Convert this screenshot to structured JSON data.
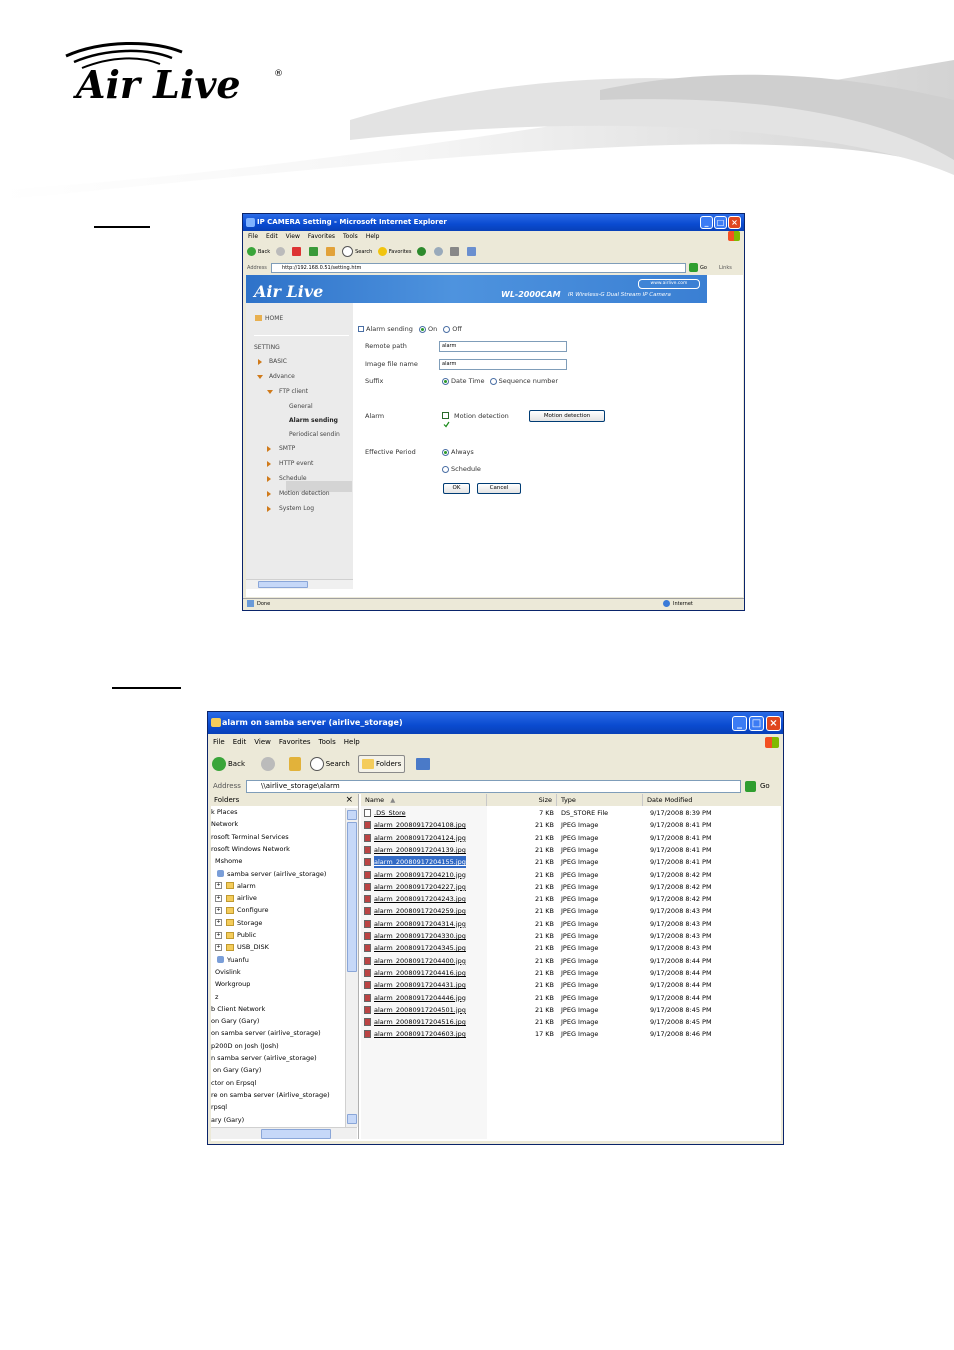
{
  "header": {
    "brand": "Air Live",
    "registered": "®"
  },
  "step_labels": [
    "",
    ""
  ],
  "ie": {
    "title": "IP CAMERA Setting - Microsoft Internet Explorer",
    "menu": [
      "File",
      "Edit",
      "View",
      "Favorites",
      "Tools",
      "Help"
    ],
    "toolbar": {
      "back": "Back",
      "search": "Search",
      "favorites": "Favorites"
    },
    "address_label": "Address",
    "address": "http://192.168.0.51/setting.htm",
    "go": "Go",
    "links": "Links",
    "banner": {
      "logo": "Air Live",
      "url": "www.airlive.com",
      "model": "WL-2000CAM",
      "subtitle": "IR Wireless-G Dual Stream IP Camera"
    },
    "nav": {
      "home": "HOME",
      "setting": "SETTING",
      "basic": "BASIC",
      "advance": "Advance",
      "ftp_client": "FTP client",
      "general": "General",
      "alarm_sending": "Alarm sending",
      "periodical": "Periodical sendin",
      "smtp": "SMTP",
      "http_event": "HTTP event",
      "schedule": "Schedule",
      "motion": "Motion detection",
      "syslog": "System Log"
    },
    "form": {
      "alarm_sending": "Alarm sending",
      "on": "On",
      "off": "Off",
      "remote_path_label": "Remote path",
      "remote_path_value": "alarm",
      "image_file_label": "Image file name",
      "image_file_value": "alarm",
      "suffix_label": "Suffix",
      "date_time": "Date Time",
      "sequence": "Sequence number",
      "alarm_label": "Alarm",
      "motion_detection": "Motion detection",
      "motion_button": "Motion detection",
      "effective_label": "Effective Period",
      "always": "Always",
      "schedule": "Schedule",
      "ok": "OK",
      "cancel": "Cancel"
    },
    "status": {
      "done": "Done",
      "zone": "Internet"
    }
  },
  "explorer": {
    "title": "alarm on samba server (airlive_storage)",
    "menu": [
      "File",
      "Edit",
      "View",
      "Favorites",
      "Tools",
      "Help"
    ],
    "toolbar": {
      "back": "Back",
      "search": "Search",
      "folders": "Folders"
    },
    "address_label": "Address",
    "address": "\\\\airlive_storage\\alarm",
    "go": "Go",
    "folders_title": "Folders",
    "close": "×",
    "tree": [
      {
        "label": "k Places",
        "indent": 0,
        "type": "text"
      },
      {
        "label": "Network",
        "indent": 0,
        "type": "text"
      },
      {
        "label": "rosoft Terminal Services",
        "indent": 0,
        "type": "text"
      },
      {
        "label": "rosoft Windows Network",
        "indent": 0,
        "type": "text"
      },
      {
        "label": "Mshome",
        "indent": 4,
        "type": "text"
      },
      {
        "label": "samba server (airlive_storage)",
        "indent": 6,
        "type": "net"
      },
      {
        "label": "alarm",
        "indent": 4,
        "type": "folder"
      },
      {
        "label": "airlive",
        "indent": 4,
        "type": "folder"
      },
      {
        "label": "Configure",
        "indent": 4,
        "type": "folder"
      },
      {
        "label": "Storage",
        "indent": 4,
        "type": "folder"
      },
      {
        "label": "Public",
        "indent": 4,
        "type": "folder"
      },
      {
        "label": "USB_DISK",
        "indent": 4,
        "type": "folder"
      },
      {
        "label": "Yuanfu",
        "indent": 6,
        "type": "net"
      },
      {
        "label": "Ovislink",
        "indent": 4,
        "type": "text"
      },
      {
        "label": "Workgroup",
        "indent": 4,
        "type": "text"
      },
      {
        "label": "z",
        "indent": 4,
        "type": "text"
      },
      {
        "label": "b Client Network",
        "indent": 0,
        "type": "text"
      },
      {
        "label": "on Gary (Gary)",
        "indent": 0,
        "type": "text"
      },
      {
        "label": "on samba server (airlive_storage)",
        "indent": 0,
        "type": "text"
      },
      {
        "label": "p200D on Josh (Josh)",
        "indent": 0,
        "type": "text"
      },
      {
        "label": "n samba server (airlive_storage)",
        "indent": 0,
        "type": "text"
      },
      {
        "label": "on Gary (Gary)",
        "indent": 2,
        "type": "text"
      },
      {
        "label": "ctor on Erpsql",
        "indent": 0,
        "type": "text"
      },
      {
        "label": "re on samba server (Airlive_storage)",
        "indent": 0,
        "type": "text"
      },
      {
        "label": "rpsql",
        "indent": 0,
        "type": "text"
      },
      {
        "label": "ary (Gary)",
        "indent": 0,
        "type": "text"
      }
    ],
    "columns": {
      "name": "Name",
      "size": "Size",
      "type": "Type",
      "date": "Date Modified"
    },
    "files": [
      {
        "name": ".DS_Store",
        "size": "7 KB",
        "type": "DS_STORE File",
        "date": "9/17/2008 8:39 PM"
      },
      {
        "name": "alarm_20080917204108.jpg",
        "size": "21 KB",
        "type": "JPEG Image",
        "date": "9/17/2008 8:41 PM"
      },
      {
        "name": "alarm_20080917204124.jpg",
        "size": "21 KB",
        "type": "JPEG Image",
        "date": "9/17/2008 8:41 PM"
      },
      {
        "name": "alarm_20080917204139.jpg",
        "size": "21 KB",
        "type": "JPEG Image",
        "date": "9/17/2008 8:41 PM"
      },
      {
        "name": "alarm_20080917204155.jpg",
        "size": "21 KB",
        "type": "JPEG Image",
        "date": "9/17/2008 8:41 PM"
      },
      {
        "name": "alarm_20080917204210.jpg",
        "size": "21 KB",
        "type": "JPEG Image",
        "date": "9/17/2008 8:42 PM"
      },
      {
        "name": "alarm_20080917204227.jpg",
        "size": "21 KB",
        "type": "JPEG Image",
        "date": "9/17/2008 8:42 PM"
      },
      {
        "name": "alarm_20080917204243.jpg",
        "size": "21 KB",
        "type": "JPEG Image",
        "date": "9/17/2008 8:42 PM"
      },
      {
        "name": "alarm_20080917204259.jpg",
        "size": "21 KB",
        "type": "JPEG Image",
        "date": "9/17/2008 8:43 PM"
      },
      {
        "name": "alarm_20080917204314.jpg",
        "size": "21 KB",
        "type": "JPEG Image",
        "date": "9/17/2008 8:43 PM"
      },
      {
        "name": "alarm_20080917204330.jpg",
        "size": "21 KB",
        "type": "JPEG Image",
        "date": "9/17/2008 8:43 PM"
      },
      {
        "name": "alarm_20080917204345.jpg",
        "size": "21 KB",
        "type": "JPEG Image",
        "date": "9/17/2008 8:43 PM"
      },
      {
        "name": "alarm_20080917204400.jpg",
        "size": "21 KB",
        "type": "JPEG Image",
        "date": "9/17/2008 8:44 PM"
      },
      {
        "name": "alarm_20080917204416.jpg",
        "size": "21 KB",
        "type": "JPEG Image",
        "date": "9/17/2008 8:44 PM"
      },
      {
        "name": "alarm_20080917204431.jpg",
        "size": "21 KB",
        "type": "JPEG Image",
        "date": "9/17/2008 8:44 PM"
      },
      {
        "name": "alarm_20080917204446.jpg",
        "size": "21 KB",
        "type": "JPEG Image",
        "date": "9/17/2008 8:44 PM"
      },
      {
        "name": "alarm_20080917204501.jpg",
        "size": "21 KB",
        "type": "JPEG Image",
        "date": "9/17/2008 8:45 PM"
      },
      {
        "name": "alarm_20080917204516.jpg",
        "size": "21 KB",
        "type": "JPEG Image",
        "date": "9/17/2008 8:45 PM"
      },
      {
        "name": "alarm_20080917204603.jpg",
        "size": "17 KB",
        "type": "JPEG Image",
        "date": "9/17/2008 8:46 PM"
      }
    ],
    "selected_file_index": 4
  },
  "colors": {
    "xp_title": "#0a4bd0",
    "banner": "#3a7fd3",
    "selection": "#316ac5",
    "brand": "#000000"
  }
}
